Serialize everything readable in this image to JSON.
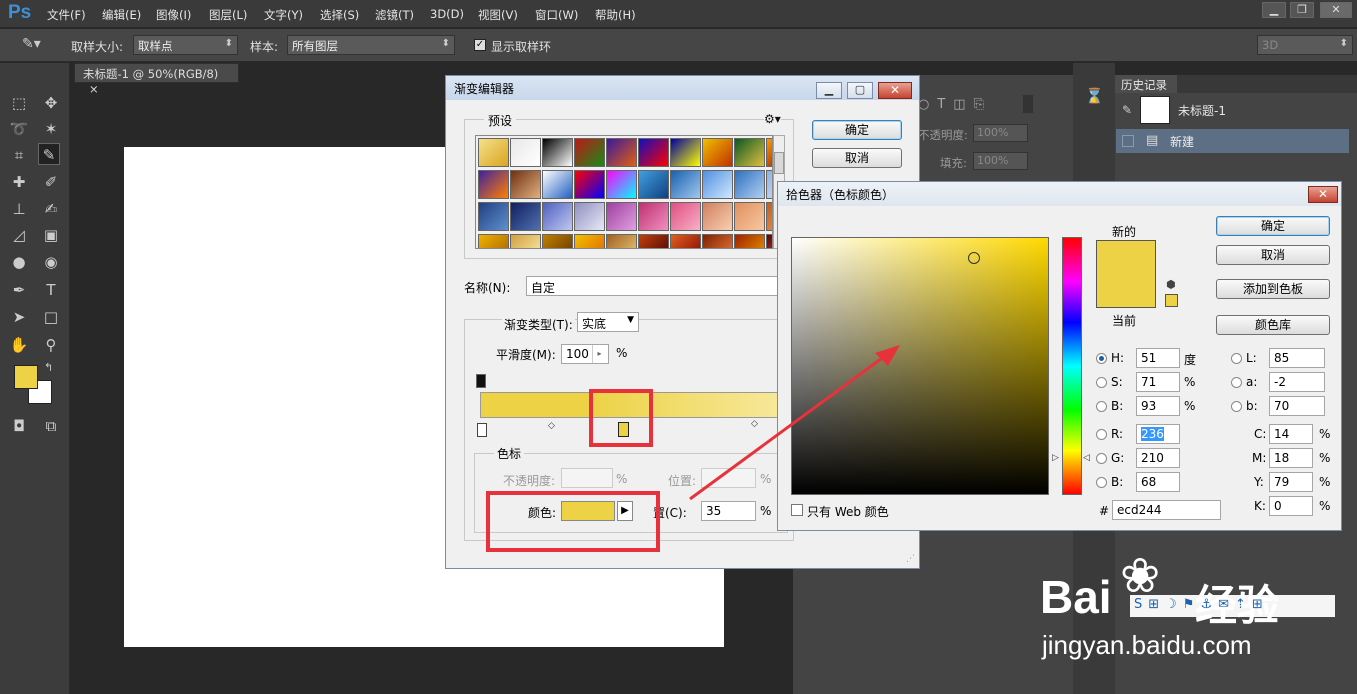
{
  "app": {
    "logo": "Ps"
  },
  "menu": [
    "文件(F)",
    "编辑(E)",
    "图像(I)",
    "图层(L)",
    "文字(Y)",
    "选择(S)",
    "滤镜(T)",
    "3D(D)",
    "视图(V)",
    "窗口(W)",
    "帮助(H)"
  ],
  "options": {
    "sample_size_label": "取样大小:",
    "sample_size_value": "取样点",
    "sample_label": "样本:",
    "sample_value": "所有图层",
    "show_ring_label": "显示取样环",
    "workspace_value": "3D"
  },
  "document": {
    "tab_title": "未标题-1 @ 50%(RGB/8)",
    "tab_close": "×"
  },
  "layers_panel": {
    "opacity_label": "不透明度:",
    "opacity_value": "100%",
    "fill_label": "填充:",
    "fill_value": "100%"
  },
  "history": {
    "title": "历史记录",
    "snapshot": "未标题-1",
    "step": "新建"
  },
  "gradient_editor": {
    "title": "渐变编辑器",
    "presets_label": "预设",
    "ok": "确定",
    "cancel": "取消",
    "name_label": "名称(N):",
    "name_value": "自定",
    "type_label": "渐变类型(T):",
    "type_value": "实底",
    "smooth_label": "平滑度(M):",
    "smooth_value": "100",
    "percent": "%",
    "stops_label": "色标",
    "opacity_label": "不透明度:",
    "position_label": "位置:",
    "color_label": "颜色:",
    "position_c_label": "置(C):",
    "position_c_value": "35"
  },
  "color_picker": {
    "title": "拾色器（色标颜色）",
    "new_label": "新的",
    "current_label": "当前",
    "ok": "确定",
    "cancel": "取消",
    "add_swatch": "添加到色板",
    "libraries": "颜色库",
    "web_only_label": "只有 Web 颜色",
    "H": {
      "label": "H:",
      "value": "51",
      "unit": "度"
    },
    "S": {
      "label": "S:",
      "value": "71",
      "unit": "%"
    },
    "Bv": {
      "label": "B:",
      "value": "93",
      "unit": "%"
    },
    "R": {
      "label": "R:",
      "value": "236"
    },
    "G": {
      "label": "G:",
      "value": "210"
    },
    "Bl": {
      "label": "B:",
      "value": "68"
    },
    "L": {
      "label": "L:",
      "value": "85"
    },
    "a": {
      "label": "a:",
      "value": "-2"
    },
    "lab_b": {
      "label": "b:",
      "value": "70"
    },
    "C": {
      "label": "C:",
      "value": "14",
      "unit": "%"
    },
    "M": {
      "label": "M:",
      "value": "18",
      "unit": "%"
    },
    "Y": {
      "label": "Y:",
      "value": "79",
      "unit": "%"
    },
    "K": {
      "label": "K:",
      "value": "0",
      "unit": "%"
    },
    "hex_label": "#",
    "hex_value": "ecd244",
    "hue_marker_fraction": 0.86
  },
  "colors": {
    "foreground": "#ecd244",
    "background": "#ffffff",
    "annotation": "#e8323b"
  },
  "watermark": {
    "brand": "Bai",
    "brand2": "经验",
    "url": "jingyan.baidu.com"
  }
}
